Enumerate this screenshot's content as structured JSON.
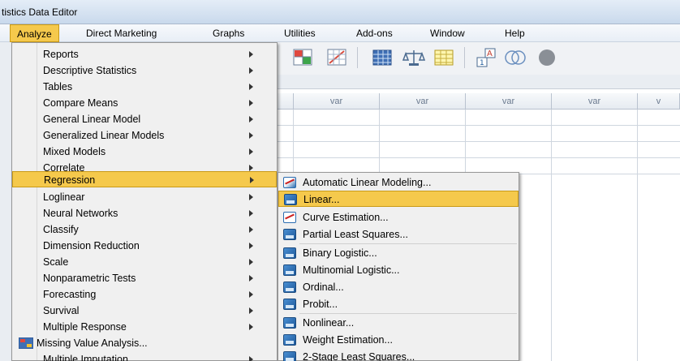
{
  "window": {
    "title": "tistics Data Editor"
  },
  "menubar": {
    "items": [
      {
        "label": "Analyze"
      },
      {
        "label": "Direct Marketing"
      },
      {
        "label": "Graphs"
      },
      {
        "label": "Utilities"
      },
      {
        "label": "Add-ons"
      },
      {
        "label": "Window"
      },
      {
        "label": "Help"
      }
    ]
  },
  "grid": {
    "col_label": "var",
    "col_label_partial": "v"
  },
  "analyze_menu": {
    "items": [
      {
        "label": "Reports"
      },
      {
        "label": "Descriptive Statistics"
      },
      {
        "label": "Tables"
      },
      {
        "label": "Compare Means"
      },
      {
        "label": "General Linear Model"
      },
      {
        "label": "Generalized Linear Models"
      },
      {
        "label": "Mixed Models"
      },
      {
        "label": "Correlate"
      },
      {
        "label": "Regression"
      },
      {
        "label": "Loglinear"
      },
      {
        "label": "Neural Networks"
      },
      {
        "label": "Classify"
      },
      {
        "label": "Dimension Reduction"
      },
      {
        "label": "Scale"
      },
      {
        "label": "Nonparametric Tests"
      },
      {
        "label": "Forecasting"
      },
      {
        "label": "Survival"
      },
      {
        "label": "Multiple Response"
      },
      {
        "label": "Missing Value Analysis..."
      },
      {
        "label": "Multiple Imputation"
      }
    ]
  },
  "regression_menu": {
    "items": [
      {
        "label": "Automatic Linear Modeling..."
      },
      {
        "label": "Linear..."
      },
      {
        "label": "Curve Estimation..."
      },
      {
        "label": "Partial Least Squares..."
      },
      {
        "label": "Binary Logistic..."
      },
      {
        "label": "Multinomial Logistic..."
      },
      {
        "label": "Ordinal..."
      },
      {
        "label": "Probit..."
      },
      {
        "label": "Nonlinear..."
      },
      {
        "label": "Weight Estimation..."
      },
      {
        "label": "2-Stage Least Squares..."
      }
    ]
  },
  "colors": {
    "highlight": "#f5c94c",
    "highlight_border": "#c99a17",
    "menu_bg": "#f0f0f0"
  }
}
